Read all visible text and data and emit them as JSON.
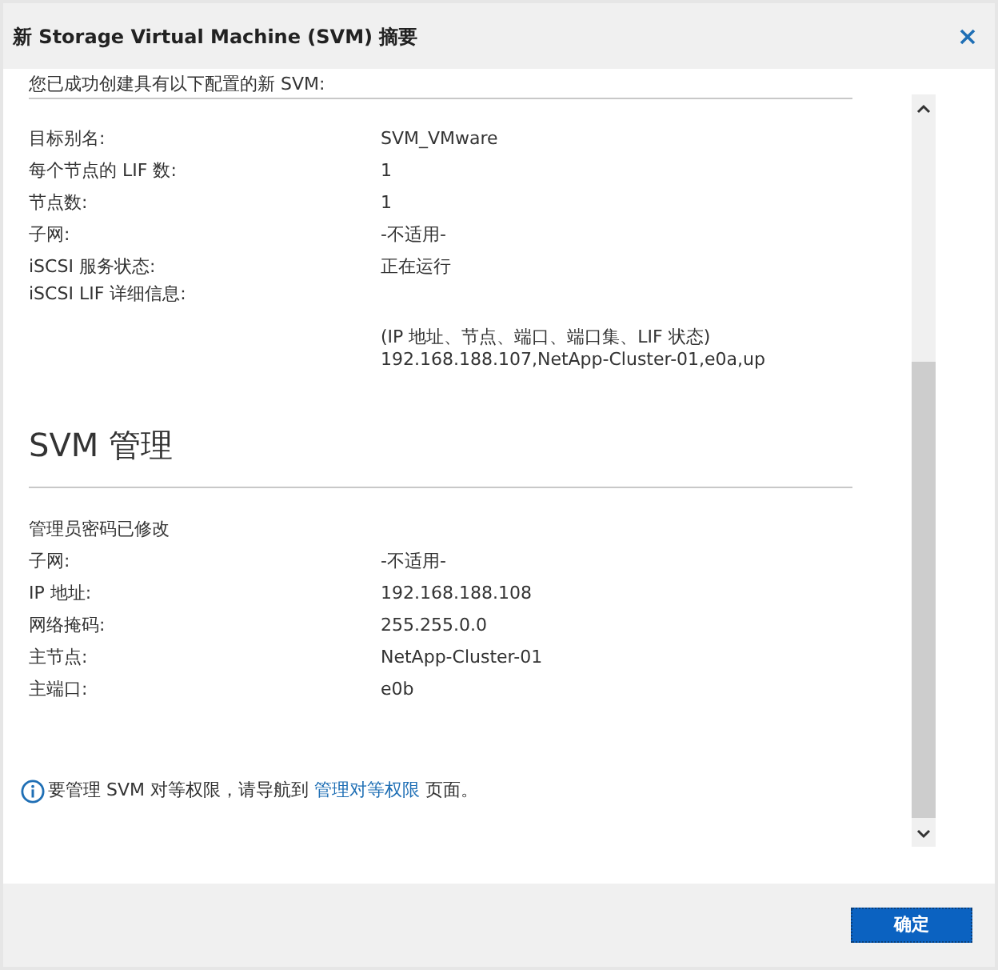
{
  "dialog": {
    "title": "新 Storage Virtual Machine (SVM) 摘要"
  },
  "intro": "您已成功创建具有以下配置的新 SVM:",
  "summary_rows": [
    {
      "label": "目标别名:",
      "value": "SVM_VMware"
    },
    {
      "label": "每个节点的 LIF 数:",
      "value": "1"
    },
    {
      "label": "节点数:",
      "value": "1"
    },
    {
      "label": "子网:",
      "value": "-不适用-"
    },
    {
      "label": "iSCSI 服务状态:",
      "value": "正在运行"
    }
  ],
  "lif_details": {
    "label": "iSCSI LIF 详细信息:",
    "header": "(IP 地址、节点、端口、端口集、LIF 状态)",
    "value": "192.168.188.107,NetApp-Cluster-01,e0a,up"
  },
  "management": {
    "heading": "SVM 管理",
    "note": "管理员密码已修改",
    "rows": [
      {
        "label": "子网:",
        "value": "-不适用-"
      },
      {
        "label": "IP 地址:",
        "value": "192.168.188.108"
      },
      {
        "label": "网络掩码:",
        "value": "255.255.0.0"
      },
      {
        "label": "主节点:",
        "value": "NetApp-Cluster-01"
      },
      {
        "label": "主端口:",
        "value": "e0b"
      }
    ]
  },
  "info": {
    "before": "要管理 SVM 对等权限，请导航到 ",
    "link": "管理对等权限",
    "after": " 页面。"
  },
  "buttons": [
    {
      "label": "确定"
    }
  ]
}
